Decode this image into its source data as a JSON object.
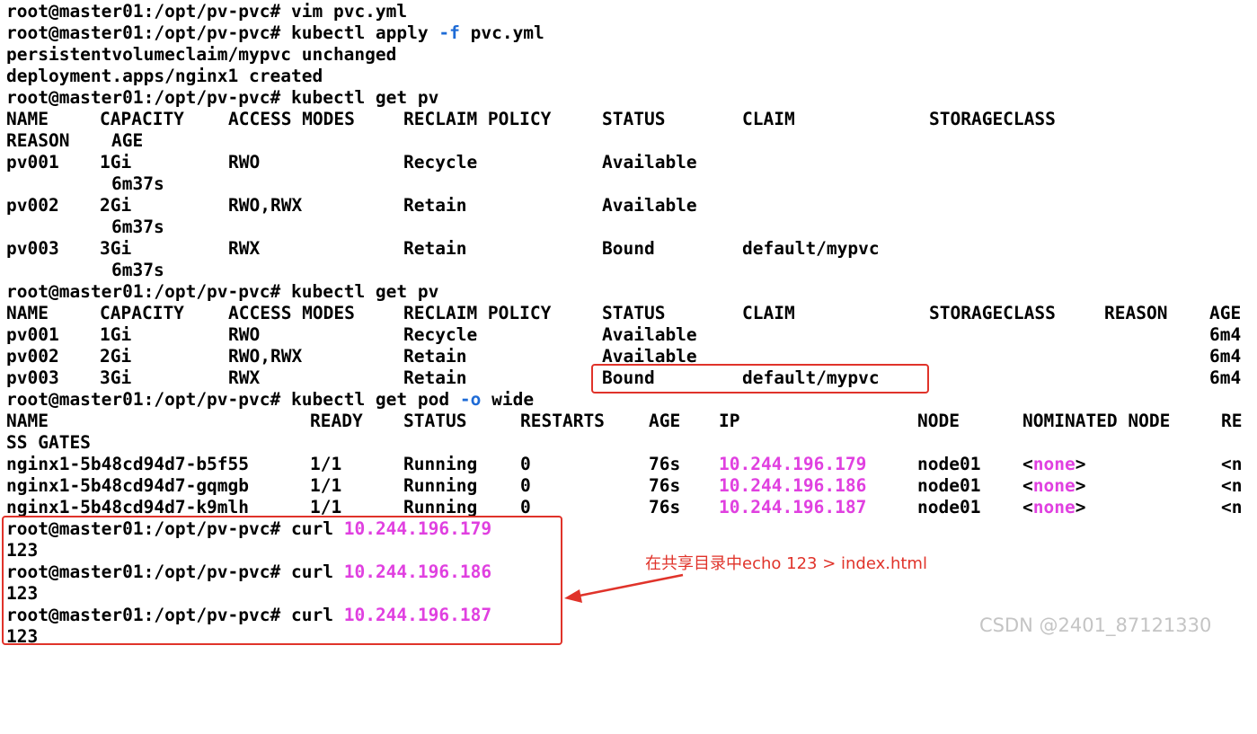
{
  "terminal": {
    "prompt": "root@master01:/opt/pv-pvc#",
    "cmd1": "vim pvc.yml",
    "cmd2": {
      "pre": "kubectl apply",
      "flag": "-f",
      "post": "pvc.yml"
    },
    "out_pvc": "persistentvolumeclaim/mypvc unchanged",
    "out_deploy": "deployment.apps/nginx1 created",
    "cmd_get_pv": "kubectl get pv",
    "pv_headers": [
      "NAME",
      "CAPACITY",
      "ACCESS MODES",
      "RECLAIM POLICY",
      "STATUS",
      "CLAIM",
      "STORAGECLASS",
      "REASON",
      "AGE"
    ],
    "pv_rows_a": [
      {
        "name": "pv001",
        "cap": "1Gi",
        "modes": "RWO",
        "policy": "Recycle",
        "status": "Available",
        "claim": "",
        "age": "6m37s"
      },
      {
        "name": "pv002",
        "cap": "2Gi",
        "modes": "RWO,RWX",
        "policy": "Retain",
        "status": "Available",
        "claim": "",
        "age": "6m37s"
      },
      {
        "name": "pv003",
        "cap": "3Gi",
        "modes": "RWX",
        "policy": "Retain",
        "status": "Bound",
        "claim": "default/mypvc",
        "age": "6m37s"
      }
    ],
    "pv_rows_b": [
      {
        "name": "pv001",
        "cap": "1Gi",
        "modes": "RWO",
        "policy": "Recycle",
        "status": "Available",
        "claim": "",
        "age": "6m4"
      },
      {
        "name": "pv002",
        "cap": "2Gi",
        "modes": "RWO,RWX",
        "policy": "Retain",
        "status": "Available",
        "claim": "",
        "age": "6m4"
      },
      {
        "name": "pv003",
        "cap": "3Gi",
        "modes": "RWX",
        "policy": "Retain",
        "status": "Bound",
        "claim": "default/mypvc",
        "age": "6m4"
      }
    ],
    "cmd_get_pod": {
      "pre": "kubectl get pod",
      "flag": "-o",
      "post": "wide"
    },
    "pod_headers": [
      "NAME",
      "READY",
      "STATUS",
      "RESTARTS",
      "AGE",
      "IP",
      "NODE",
      "NOMINATED NODE",
      "RE"
    ],
    "pod_header_wrap": "SS GATES",
    "pods": [
      {
        "name": "nginx1-5b48cd94d7-b5f55",
        "ready": "1/1",
        "status": "Running",
        "restarts": "0",
        "age": "76s",
        "ip": "10.244.196.179",
        "node": "node01",
        "nom_open": "<",
        "nom_val": "none",
        "nom_close": ">",
        "re": "<n"
      },
      {
        "name": "nginx1-5b48cd94d7-gqmgb",
        "ready": "1/1",
        "status": "Running",
        "restarts": "0",
        "age": "76s",
        "ip": "10.244.196.186",
        "node": "node01",
        "nom_open": "<",
        "nom_val": "none",
        "nom_close": ">",
        "re": "<n"
      },
      {
        "name": "nginx1-5b48cd94d7-k9mlh",
        "ready": "1/1",
        "status": "Running",
        "restarts": "0",
        "age": "76s",
        "ip": "10.244.196.187",
        "node": "node01",
        "nom_open": "<",
        "nom_val": "none",
        "nom_close": ">",
        "re": "<n"
      }
    ],
    "curl_cmd": "curl",
    "curls": [
      {
        "ip": "10.244.196.179",
        "out": "123"
      },
      {
        "ip": "10.244.196.186",
        "out": "123"
      },
      {
        "ip": "10.244.196.187",
        "out": "123"
      }
    ]
  },
  "annotation": {
    "text": "在共享目录中echo 123 > index.html"
  },
  "watermark": "CSDN @2401_87121330",
  "colors": {
    "flag": "#1e6bd6",
    "ip": "#e040e0",
    "highlight": "#e0332a"
  }
}
